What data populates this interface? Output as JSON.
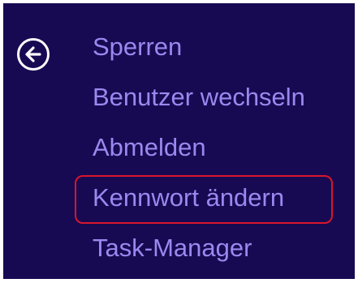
{
  "back_button": {
    "icon": "arrow-left-circle-icon",
    "color": "#ffffff"
  },
  "menu": {
    "text_color": "#9b88ef",
    "background": "#180a52",
    "highlight_color": "#d9152b",
    "items": [
      {
        "label": "Sperren"
      },
      {
        "label": "Benutzer wechseln"
      },
      {
        "label": "Abmelden"
      },
      {
        "label": "Kennwort ändern",
        "highlighted": true
      },
      {
        "label": "Task-Manager"
      }
    ]
  }
}
